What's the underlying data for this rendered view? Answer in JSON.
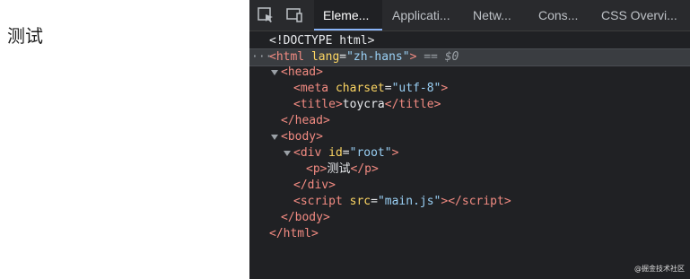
{
  "page": {
    "text": "测试"
  },
  "devtools": {
    "tabs": [
      {
        "label": "Eleme...",
        "active": true
      },
      {
        "label": "Applicati...",
        "active": false
      },
      {
        "label": "Netw...",
        "active": false
      },
      {
        "label": "Cons...",
        "active": false
      },
      {
        "label": "CSS Overvi...",
        "active": false
      }
    ],
    "icons": [
      "inspect-element-icon",
      "device-toolbar-icon"
    ],
    "tree": {
      "doctype": "<!DOCTYPE html>",
      "html_open": "html",
      "html_lang_attr": "lang",
      "html_lang_val": "\"zh-hans\"",
      "selected_marker": "== $0",
      "head": "head",
      "meta": "meta",
      "meta_attr": "charset",
      "meta_val": "\"utf-8\"",
      "title_tag": "title",
      "title_text": "toycra",
      "body": "body",
      "div": "div",
      "div_attr": "id",
      "div_val": "\"root\"",
      "p_tag": "p",
      "p_text": "测试",
      "script": "script",
      "script_attr": "src",
      "script_val": "\"main.js\""
    }
  },
  "watermark": "@掘金技术社区",
  "colors": {
    "tag": "#f28b82",
    "attr": "#fdd663",
    "value": "#9ad0f5",
    "selection": "#3a3d41",
    "accent": "#8ab4f8"
  }
}
